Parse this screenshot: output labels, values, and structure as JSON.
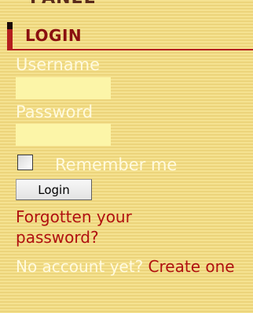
{
  "section_above": {
    "title_fragment": "PANEL"
  },
  "login_module": {
    "title": "LOGIN",
    "username_label": "Username",
    "username_value": "",
    "password_label": "Password",
    "password_value": "",
    "remember_label": "Remember me",
    "remember_checked": false,
    "login_button_label": "Login",
    "forgot_link": "Forgotten your password?",
    "no_account_text": "No account yet?",
    "create_link": "Create one"
  },
  "colors": {
    "background": "#f2dc88",
    "accent_red": "#b41e1e",
    "title_red": "#8a1010",
    "link_red": "#b01010",
    "label_light": "#fffadf",
    "input_fill": "#fcf5a8"
  }
}
